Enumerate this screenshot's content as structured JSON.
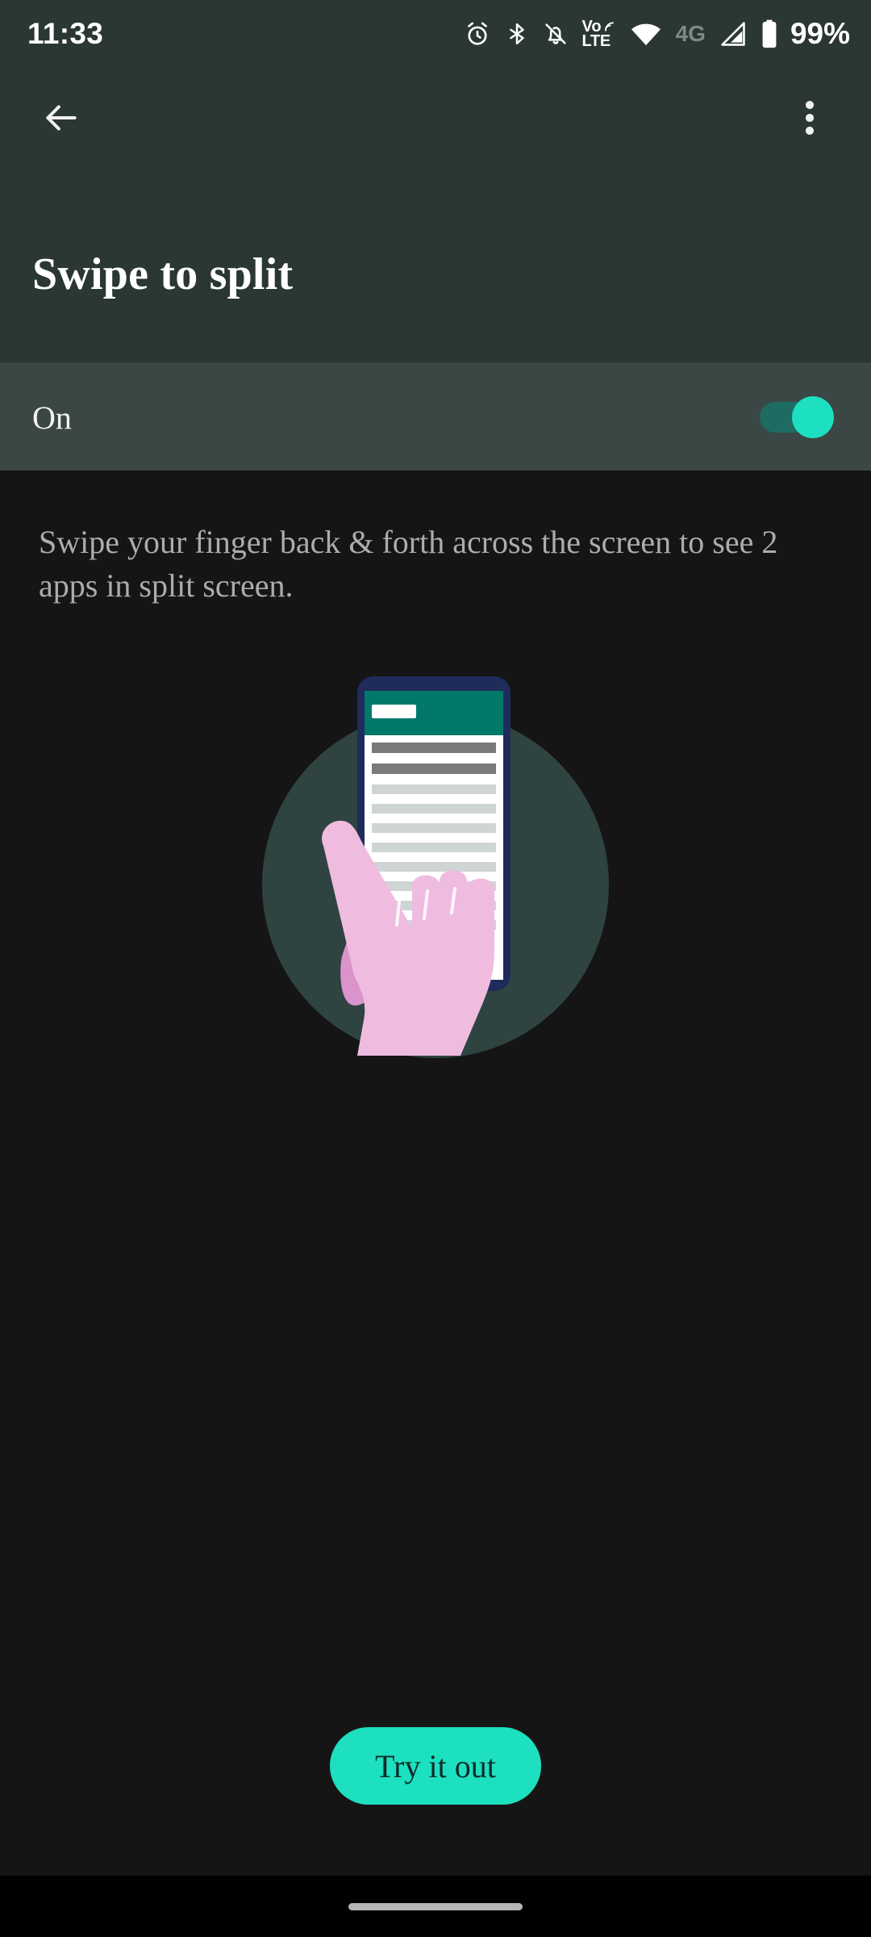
{
  "status_bar": {
    "time": "11:33",
    "battery_percent": "99%",
    "network_label": "4G",
    "volte_top": "Vo",
    "volte_bottom": "LTE",
    "icons": [
      "alarm-icon",
      "bluetooth-icon",
      "vibrate-off-icon",
      "volte-icon",
      "wifi-icon",
      "network-4g-label",
      "signal-icon",
      "battery-icon"
    ]
  },
  "app_bar": {
    "back_label": "Back",
    "overflow_label": "More options",
    "title": "Swipe to split"
  },
  "toggle_row": {
    "label": "On",
    "state": "on"
  },
  "content": {
    "description": "Swipe your finger back & forth across the screen to see 2 apps in split screen.",
    "illustration_name": "swipe-to-split-illustration"
  },
  "cta": {
    "label": "Try it out"
  },
  "nav_bar": {
    "pill_label": "Home gesture bar"
  },
  "colors": {
    "accent": "#1DE0C0",
    "header_bg": "#2A3733",
    "toggle_row_bg": "#3B4745",
    "page_bg": "#151515",
    "nav_bg": "#000000",
    "body_text": "#ACACAC",
    "title_text": "#FFFFFF",
    "illustration_circle": "#2F4340",
    "illustration_phone_frame": "#1F2B5B",
    "illustration_appbar": "#00796B",
    "illustration_hand": "#EFBCE0",
    "illustration_hand_shadow": "#DB93CC",
    "cta_text": "#0D2B27"
  }
}
